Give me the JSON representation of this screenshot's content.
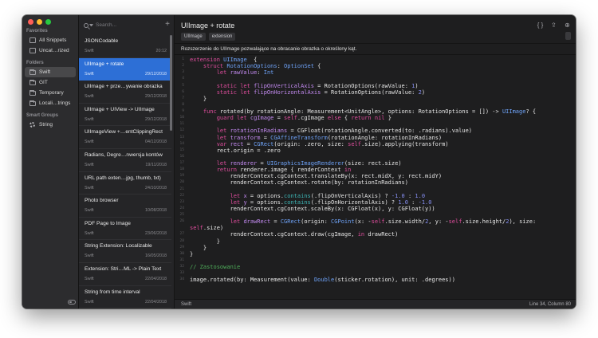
{
  "sidebar": {
    "sections": [
      {
        "header": "Favorites",
        "items": [
          {
            "label": "All Snippets",
            "icon": "inbox-icon"
          },
          {
            "label": "Uncat…rized",
            "icon": "inbox-icon"
          }
        ]
      },
      {
        "header": "Folders",
        "items": [
          {
            "label": "Swift",
            "icon": "folder-icon",
            "active": true
          },
          {
            "label": "GIT",
            "icon": "folder-icon"
          },
          {
            "label": "Temporary",
            "icon": "folder-icon"
          },
          {
            "label": "Locali…trings",
            "icon": "folder-icon"
          }
        ]
      },
      {
        "header": "Smart Groups",
        "items": [
          {
            "label": "String",
            "icon": "gear-icon"
          }
        ]
      }
    ]
  },
  "list": {
    "search_placeholder": "Search...",
    "add_label": "+",
    "items": [
      {
        "title": "JSONCodable",
        "lang": "Swift",
        "date": "20:12"
      },
      {
        "title": "UIImage + rotate",
        "lang": "Swift",
        "date": "29/12/2018",
        "active": true
      },
      {
        "title": "UIImage + prze…ywanie obrazka",
        "lang": "Swift",
        "date": "29/12/2018"
      },
      {
        "title": "UIImage + UIView -> UIImage",
        "lang": "Swift",
        "date": "29/12/2018"
      },
      {
        "title": "UIImageView +…entClippingRect",
        "lang": "Swift",
        "date": "04/12/2018"
      },
      {
        "title": "Radians, Degre…nwersja kontów",
        "lang": "Swift",
        "date": "19/11/2018"
      },
      {
        "title": "URL path exten…jpg, thumb, txt)",
        "lang": "Swift",
        "date": "24/10/2018"
      },
      {
        "title": "Photo browser",
        "lang": "Swift",
        "date": "10/08/2018"
      },
      {
        "title": "PDF Page to Image",
        "lang": "Swift",
        "date": "23/06/2018"
      },
      {
        "title": "String Extension: Localizable",
        "lang": "Swift",
        "date": "16/05/2018"
      },
      {
        "title": "Extension: Stri…ML -> Plain Text",
        "lang": "Swift",
        "date": "22/04/2018"
      },
      {
        "title": "String from time interval",
        "lang": "Swift",
        "date": "22/04/2018"
      }
    ]
  },
  "editor": {
    "title": "UIImage + rotate",
    "tags": [
      "UIImage",
      "extension"
    ],
    "toolbar_icons": [
      "braces-icon",
      "share-icon",
      "add-circle-icon"
    ],
    "description": "Rozszerzenie do UIImage pozwalające na obracanie obrazka o określony kąt.",
    "line_numbers": [
      "1",
      "2",
      "3",
      "4",
      "5",
      "6",
      "7",
      "8",
      "9",
      "10",
      "11",
      "12",
      "13",
      "14",
      "15",
      "16",
      "17",
      "18",
      "19",
      "20",
      "21",
      "22",
      "23",
      "24",
      "25",
      "26",
      "27",
      "28",
      "29",
      "30",
      "31",
      "32",
      "33",
      "34"
    ],
    "status_language": "Swift",
    "status_position": "Line 34, Column 80"
  },
  "colors": {
    "keyword": "#e04d9e",
    "type": "#6ea2f7",
    "method": "#3db5b5",
    "property": "#c48bf2",
    "number": "#8790f4",
    "comment": "#4fae5a",
    "selection": "#2d6fd6"
  },
  "code_lines": [
    [
      [
        "k",
        "extension "
      ],
      [
        "t",
        "UIImage"
      ],
      [
        "",
        "  {"
      ]
    ],
    [
      [
        "",
        "    "
      ],
      [
        "k",
        "struct "
      ],
      [
        "t",
        "RotationOptions"
      ],
      [
        "",
        ": "
      ],
      [
        "t",
        "OptionSet"
      ],
      [
        "",
        " {"
      ]
    ],
    [
      [
        "",
        "        "
      ],
      [
        "k",
        "let "
      ],
      [
        "p",
        "rawValue"
      ],
      [
        "",
        ": "
      ],
      [
        "t",
        "Int"
      ]
    ],
    [],
    [
      [
        "",
        "        "
      ],
      [
        "k",
        "static let "
      ],
      [
        "p",
        "flipOnVerticalAxis"
      ],
      [
        "",
        " = RotationOptions(rawValue: "
      ],
      [
        "n",
        "1"
      ],
      [
        "",
        ")"
      ]
    ],
    [
      [
        "",
        "        "
      ],
      [
        "k",
        "static let "
      ],
      [
        "p",
        "flipOnHorizontalAxis"
      ],
      [
        "",
        " = RotationOptions(rawValue: "
      ],
      [
        "n",
        "2"
      ],
      [
        "",
        ")"
      ]
    ],
    [
      [
        "",
        "    }"
      ]
    ],
    [],
    [
      [
        "",
        "    "
      ],
      [
        "k",
        "func "
      ],
      [
        "",
        "rotated(by rotationAngle: Measurement<UnitAngle>, options: RotationOptions = []) -> "
      ],
      [
        "t",
        "UIImage"
      ],
      [
        "",
        "? {"
      ]
    ],
    [
      [
        "",
        "        "
      ],
      [
        "k",
        "guard let "
      ],
      [
        "p",
        "cgImage"
      ],
      [
        "",
        " = "
      ],
      [
        "k",
        "self"
      ],
      [
        "",
        ".cgImage "
      ],
      [
        "k",
        "else "
      ],
      [
        "",
        "{ "
      ],
      [
        "k",
        "return nil"
      ],
      [
        "",
        " }"
      ]
    ],
    [],
    [
      [
        "",
        "        "
      ],
      [
        "k",
        "let "
      ],
      [
        "p",
        "rotationInRadians"
      ],
      [
        "",
        " = CGFloat(rotationAngle.converted(to: .radians).value)"
      ]
    ],
    [
      [
        "",
        "        "
      ],
      [
        "k",
        "let "
      ],
      [
        "p",
        "transform"
      ],
      [
        "",
        " = "
      ],
      [
        "t",
        "CGAffineTransform"
      ],
      [
        "",
        "(rotationAngle: rotationInRadians)"
      ]
    ],
    [
      [
        "",
        "        "
      ],
      [
        "k",
        "var "
      ],
      [
        "p",
        "rect"
      ],
      [
        "",
        " = "
      ],
      [
        "t",
        "CGRect"
      ],
      [
        "",
        "(origin: .zero, size: "
      ],
      [
        "k",
        "self"
      ],
      [
        "",
        ".size).applying(transform)"
      ]
    ],
    [
      [
        "",
        "        rect.origin = .zero"
      ]
    ],
    [],
    [
      [
        "",
        "        "
      ],
      [
        "k",
        "let "
      ],
      [
        "p",
        "renderer"
      ],
      [
        "",
        " = "
      ],
      [
        "t",
        "UIGraphicsImageRenderer"
      ],
      [
        "",
        "(size: rect.size)"
      ]
    ],
    [
      [
        "",
        "        "
      ],
      [
        "k",
        "return "
      ],
      [
        "",
        "renderer.image { renderContext "
      ],
      [
        "k",
        "in"
      ]
    ],
    [
      [
        "",
        "            renderContext.cgContext.translateBy(x: rect.midX, y: rect.midY)"
      ]
    ],
    [
      [
        "",
        "            renderContext.cgContext.rotate(by: rotationInRadians)"
      ]
    ],
    [],
    [
      [
        "",
        "            "
      ],
      [
        "k",
        "let "
      ],
      [
        "p",
        "x"
      ],
      [
        "",
        " = options."
      ],
      [
        "m",
        "contains"
      ],
      [
        "",
        "(.flipOnVerticalAxis) ? "
      ],
      [
        "n",
        "-1.0"
      ],
      [
        "",
        " : "
      ],
      [
        "n",
        "1.0"
      ]
    ],
    [
      [
        "",
        "            "
      ],
      [
        "k",
        "let "
      ],
      [
        "p",
        "y"
      ],
      [
        "",
        " = options."
      ],
      [
        "m",
        "contains"
      ],
      [
        "",
        "(.flipOnHorizontalAxis) ? "
      ],
      [
        "n",
        "1.0"
      ],
      [
        "",
        " : "
      ],
      [
        "n",
        "-1.0"
      ]
    ],
    [
      [
        "",
        "            renderContext.cgContext.scaleBy(x: CGFloat(x), y: CGFloat(y))"
      ]
    ],
    [],
    [
      [
        "",
        "            "
      ],
      [
        "k",
        "let "
      ],
      [
        "p",
        "drawRect"
      ],
      [
        "",
        " = "
      ],
      [
        "t",
        "CGRect"
      ],
      [
        "",
        "(origin: "
      ],
      [
        "t",
        "CGPoint"
      ],
      [
        "",
        "(x: -"
      ],
      [
        "k",
        "self"
      ],
      [
        "",
        ".size.width/"
      ],
      [
        "n",
        "2"
      ],
      [
        "",
        ", y: -"
      ],
      [
        "k",
        "self"
      ],
      [
        "",
        ".size.height/"
      ],
      [
        "n",
        "2"
      ],
      [
        "",
        "), size: "
      ],
      [
        "k",
        "self"
      ],
      [
        "",
        ".size)"
      ]
    ],
    [
      [
        "",
        "            renderContext.cgContext.draw(cgImage, "
      ],
      [
        "k",
        "in"
      ],
      [
        "",
        " drawRect)"
      ]
    ],
    [
      [
        "",
        "        }"
      ]
    ],
    [
      [
        "",
        "    }"
      ]
    ],
    [
      [
        "",
        "}"
      ]
    ],
    [],
    [
      [
        "c",
        "// Zastosowanie"
      ]
    ],
    [],
    [
      [
        "",
        "image.rotated(by: Measurement(value: "
      ],
      [
        "t",
        "Double"
      ],
      [
        "",
        "(sticker.rotation), unit: .degrees))"
      ]
    ]
  ]
}
